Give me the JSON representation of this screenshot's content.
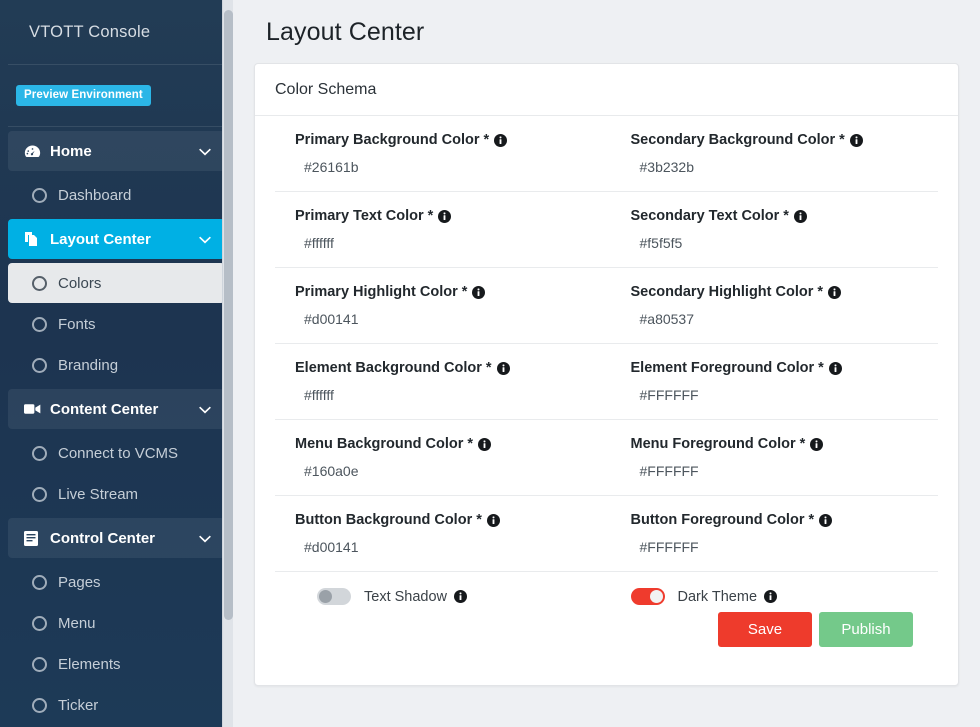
{
  "sidebar": {
    "brand": "VTOTT Console",
    "badge": "Preview Environment",
    "items": [
      {
        "label": "Home",
        "type": "group",
        "icon": "tachometer-icon",
        "caret": "chevron-down-icon",
        "state": "expanded"
      },
      {
        "label": "Dashboard",
        "type": "sub",
        "icon": "circle-icon"
      },
      {
        "label": "Layout Center",
        "type": "group",
        "icon": "copy-files-icon",
        "caret": "chevron-down-icon",
        "state": "active"
      },
      {
        "label": "Colors",
        "type": "sub",
        "icon": "circle-icon",
        "state": "current"
      },
      {
        "label": "Fonts",
        "type": "sub",
        "icon": "circle-icon"
      },
      {
        "label": "Branding",
        "type": "sub",
        "icon": "circle-icon"
      },
      {
        "label": "Content Center",
        "type": "group",
        "icon": "video-camera-icon",
        "caret": "chevron-down-icon",
        "state": "expanded"
      },
      {
        "label": "Connect to VCMS",
        "type": "sub",
        "icon": "circle-icon"
      },
      {
        "label": "Live Stream",
        "type": "sub",
        "icon": "circle-icon"
      },
      {
        "label": "Control Center",
        "type": "group",
        "icon": "book-icon",
        "caret": "chevron-down-icon",
        "state": "expanded"
      },
      {
        "label": "Pages",
        "type": "sub",
        "icon": "circle-icon"
      },
      {
        "label": "Menu",
        "type": "sub",
        "icon": "circle-icon"
      },
      {
        "label": "Elements",
        "type": "sub",
        "icon": "circle-icon"
      },
      {
        "label": "Ticker",
        "type": "sub",
        "icon": "circle-icon"
      }
    ]
  },
  "page": {
    "title": "Layout Center"
  },
  "card": {
    "header": "Color Schema",
    "required_marker": "*",
    "info_icon": "info-circle-icon",
    "fields": [
      {
        "label": "Primary Background Color",
        "value": "#26161b"
      },
      {
        "label": "Secondary Background Color",
        "value": "#3b232b"
      },
      {
        "label": "Primary Text Color",
        "value": "#ffffff"
      },
      {
        "label": "Secondary Text Color",
        "value": "#f5f5f5"
      },
      {
        "label": "Primary Highlight Color",
        "value": "#d00141"
      },
      {
        "label": "Secondary Highlight Color",
        "value": "#a80537"
      },
      {
        "label": "Element Background Color",
        "value": "#ffffff"
      },
      {
        "label": "Element Foreground Color",
        "value": "#FFFFFF"
      },
      {
        "label": "Menu Background Color",
        "value": "#160a0e"
      },
      {
        "label": "Menu Foreground Color",
        "value": "#FFFFFF"
      },
      {
        "label": "Button Background Color",
        "value": "#d00141"
      },
      {
        "label": "Button Foreground Color",
        "value": "#FFFFFF"
      }
    ],
    "toggles": [
      {
        "label": "Text Shadow",
        "on": false
      },
      {
        "label": "Dark Theme",
        "on": true
      }
    ],
    "buttons": {
      "save": "Save",
      "publish": "Publish"
    }
  },
  "colors": {
    "sidebar_bg": "#1d3450",
    "sidebar_active": "#00b0e4",
    "badge_bg": "#2bb6e7",
    "save_bg": "#ee3b2c",
    "publish_bg": "#74c98a",
    "toggle_on": "#ef3b2d",
    "page_bg": "#eef0f3"
  }
}
